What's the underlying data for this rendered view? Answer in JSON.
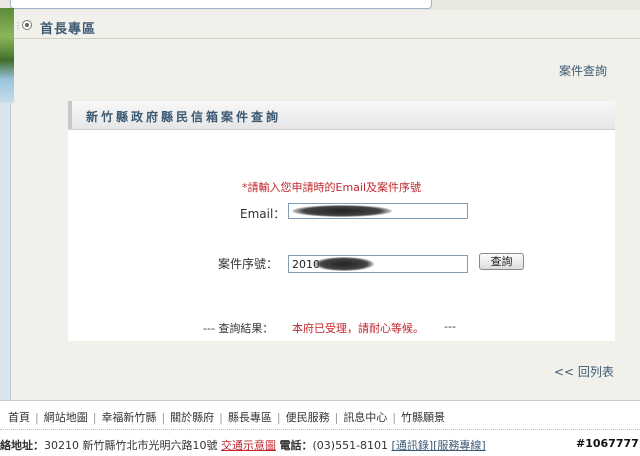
{
  "section": {
    "title": "首長專區"
  },
  "case_query_link": "案件查詢",
  "panel": {
    "title": "新竹縣政府縣民信箱案件查詢",
    "notice": "*請輸入您申請時的Email及案件序號",
    "email_label": "Email：",
    "email_value": "",
    "case_label": "案件序號：",
    "case_value": "2010",
    "query_button": "查詢",
    "result_prefix": "--- 查詢結果：",
    "result_text": "本府已受理，請耐心等候。",
    "result_suffix": "---"
  },
  "back_link": "<< 回列表",
  "footer": {
    "nav": [
      "首頁",
      "網站地圖",
      "幸福新竹縣",
      "關於縣府",
      "縣長專區",
      "便民服務",
      "訊息中心",
      "竹縣願景"
    ],
    "address_label": "絡地址：",
    "address": "30210 新竹縣竹北市光明六路10號",
    "map_link": "交通示意圖",
    "phone_label": "電話：",
    "phone": "(03)551-8101",
    "phone_link1": "[通訊錄]",
    "phone_link2": "[服務專線]"
  },
  "watermark": "#1067777"
}
